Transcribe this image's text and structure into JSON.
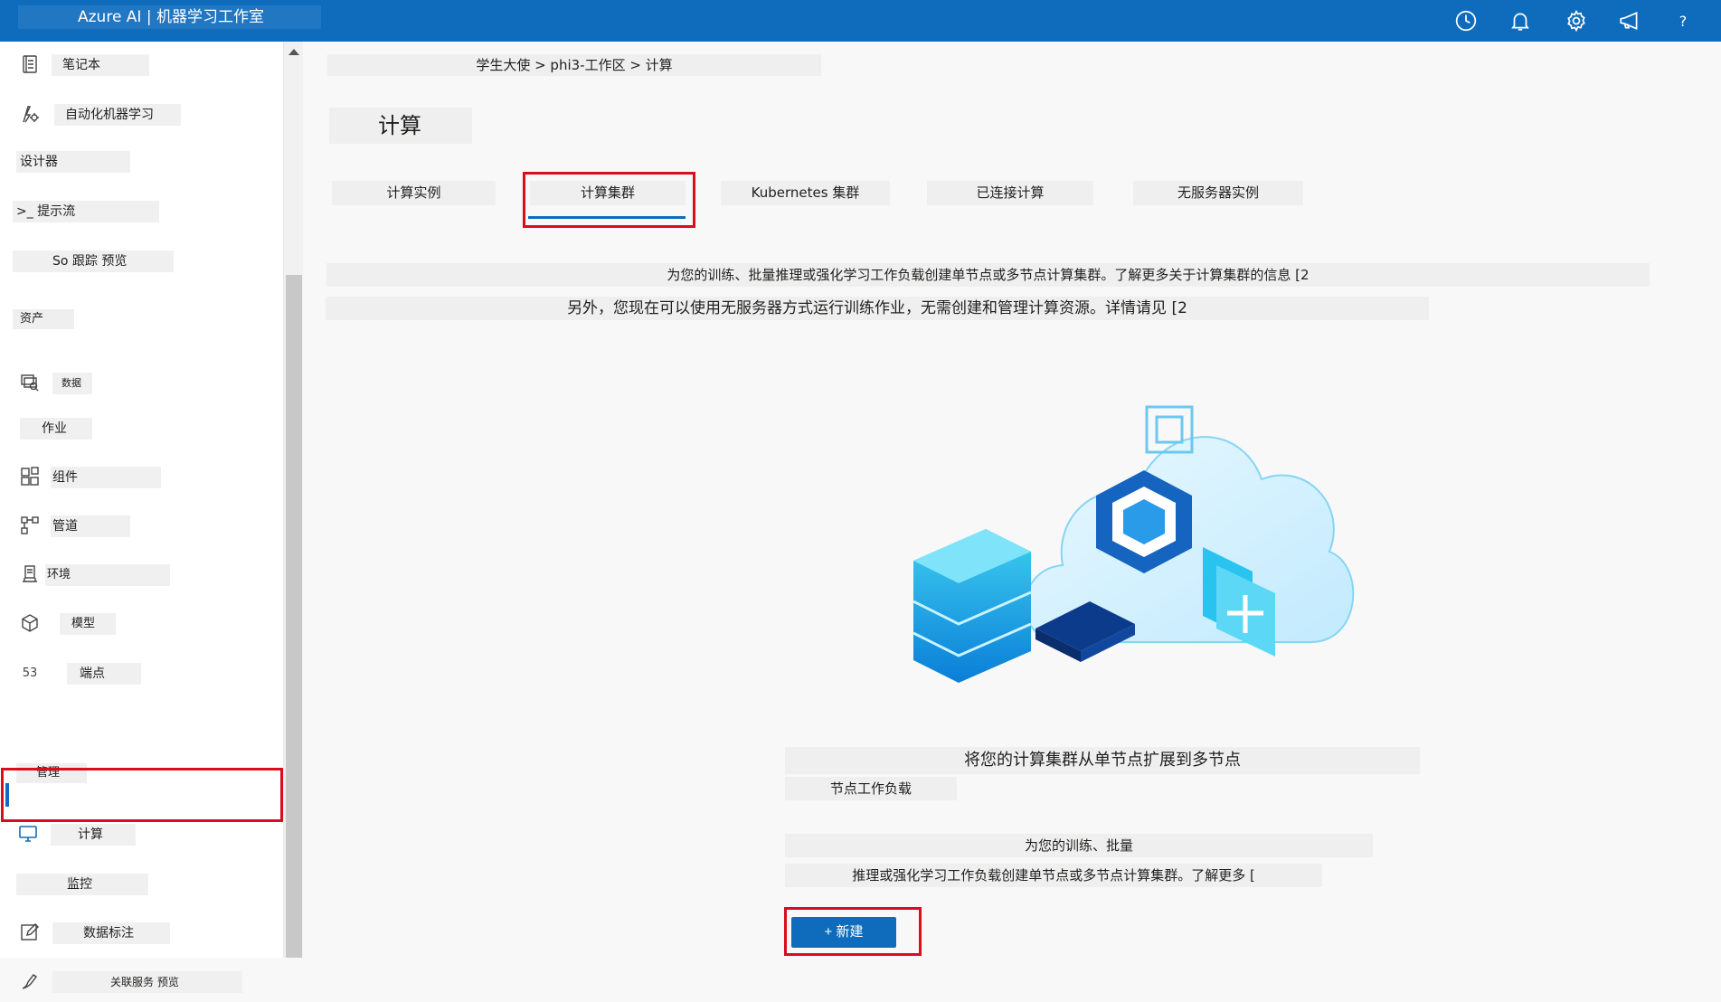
{
  "app": {
    "title": "Azure AI | 机器学习工作室"
  },
  "topbar": {
    "icons": [
      "clock-icon",
      "bell-icon",
      "gear-icon",
      "megaphone-icon",
      "help-icon",
      "smiley-icon"
    ],
    "help_text": "?"
  },
  "sidebar": {
    "items": [
      {
        "id": "notebook",
        "label": "笔记本",
        "icon": "notebook-icon"
      },
      {
        "id": "automl",
        "label": "自动化机器学习",
        "icon": "automl-icon"
      },
      {
        "id": "designer",
        "label": "设计器",
        "icon": ""
      },
      {
        "id": "promptflow",
        "label": ">_ 提示流",
        "icon": ""
      },
      {
        "id": "tracing",
        "label": "So 跟踪 预览",
        "icon": ""
      },
      {
        "id": "data",
        "label": "数据",
        "icon": "data-icon"
      },
      {
        "id": "jobs",
        "label": "作业",
        "icon": ""
      },
      {
        "id": "components",
        "label": "组件",
        "icon": "components-icon"
      },
      {
        "id": "pipelines",
        "label": "管道",
        "icon": "pipeline-icon"
      },
      {
        "id": "environments",
        "label": "环境",
        "icon": "environment-icon"
      },
      {
        "id": "models",
        "label": "模型",
        "icon": "model-cube-icon"
      },
      {
        "id": "endpoints",
        "label": "端点",
        "icon": "endpoint-icon"
      },
      {
        "id": "compute",
        "label": "计算",
        "icon": "monitor-icon"
      },
      {
        "id": "monitoring",
        "label": "监控",
        "icon": ""
      },
      {
        "id": "labeling",
        "label": "数据标注",
        "icon": "edit-icon"
      },
      {
        "id": "linked",
        "label": "关联服务 预览",
        "icon": "link-icon"
      }
    ],
    "sections": {
      "assets": "资产",
      "manage": "管理"
    },
    "endpoint_badge": "53"
  },
  "main": {
    "breadcrumb": "学生大使 > phi3-工作区 > 计算",
    "title": "计算",
    "tabs": [
      "计算实例",
      "计算集群",
      "Kubernetes 集群",
      "已连接计算",
      "无服务器实例"
    ],
    "selected_tab": "计算集群",
    "info1": "为您的训练、批量推理或强化学习工作负载创建单节点或多节点计算集群。了解更多关于计算集群的信息 [2",
    "info2": "另外，您现在可以使用无服务器方式运行训练作业，无需创建和管理计算资源。详情请见 [2",
    "empty_title": "将您的计算集群从单节点扩展到多节点",
    "empty_sub": "节点工作负载",
    "empty_desc1": "为您的训练、批量",
    "empty_desc2": "推理或强化学习工作负载创建单节点或多节点计算集群。了解更多 [",
    "new_button": "+ 新建"
  },
  "colors": {
    "brand": "#0f6cbd",
    "highlight": "#d80d1e"
  }
}
